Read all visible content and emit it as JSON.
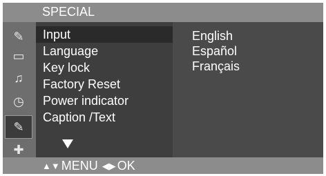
{
  "header": {
    "title": "SPECIAL"
  },
  "sidebar_icons": [
    {
      "name": "picture-icon",
      "glyph": "✎"
    },
    {
      "name": "screen-icon",
      "glyph": "▭"
    },
    {
      "name": "speaker-icon",
      "glyph": "♫"
    },
    {
      "name": "time-icon",
      "glyph": "◷"
    },
    {
      "name": "special-icon",
      "glyph": "✎"
    },
    {
      "name": "tool-icon",
      "glyph": "✚"
    }
  ],
  "menu": {
    "items": [
      {
        "label": "Input"
      },
      {
        "label": "Language"
      },
      {
        "label": "Key lock"
      },
      {
        "label": "Factory Reset"
      },
      {
        "label": "Power indicator"
      },
      {
        "label": "Caption /Text"
      }
    ]
  },
  "options": {
    "items": [
      {
        "label": "English"
      },
      {
        "label": "Español"
      },
      {
        "label": "Français"
      }
    ]
  },
  "footer": {
    "updown_glyph": "▲▼",
    "menu_label": "MENU",
    "leftright_glyph": "◀▶",
    "ok_label": "OK"
  }
}
